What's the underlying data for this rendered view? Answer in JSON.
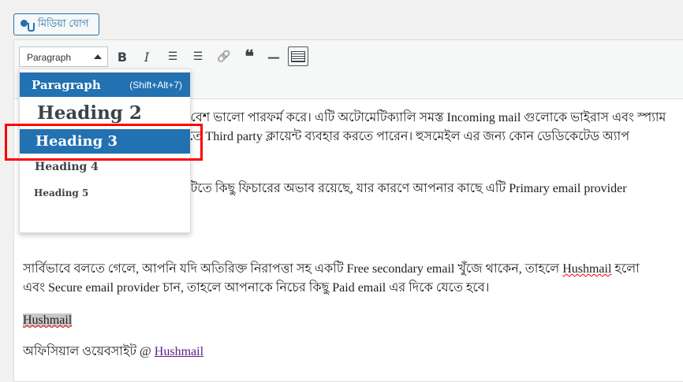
{
  "media_button": {
    "label": "মিডিয়া যোগ",
    "icon": "add-media-icon"
  },
  "toolbar": {
    "format_select": {
      "value": "Paragraph"
    },
    "buttons": [
      {
        "name": "bold",
        "glyph": "B"
      },
      {
        "name": "italic",
        "glyph": "I"
      },
      {
        "name": "bulleted-list",
        "glyph": "☰"
      },
      {
        "name": "numbered-list",
        "glyph": "☰"
      },
      {
        "name": "link",
        "glyph": "🔗"
      },
      {
        "name": "blockquote",
        "glyph": "❝"
      },
      {
        "name": "horizontal-line",
        "glyph": "—"
      },
      {
        "name": "toolbar-toggle",
        "glyph": ""
      }
    ]
  },
  "format_dropdown": {
    "items": [
      {
        "label": "Paragraph",
        "shortcut": "(Shift+Alt+7)"
      },
      {
        "label": "Heading 2"
      },
      {
        "label": "Heading 3"
      },
      {
        "label": "Heading 4"
      },
      {
        "label": "Heading 5"
      }
    ],
    "highlighted": "Heading 3",
    "accent": "#2271b1"
  },
  "content": {
    "lines": [
      "খুব বেশ ভালো পারফর্ম করে। এটি অটোমেটিক্যালি সমস্ত Incoming mail গুলোকে ভাইরাস এবং স্প্যাম",
      "করতে Third party ক্লায়েন্ট ব্যবহার করতে পারেন। হুসমেইল এর জন্য কোন ডেডিকেটেড অ্যাপ",
      "শনটিতে কিছু ফিচারের অভাব রয়েছে, যার কারণে আপনার কাছে এটি Primary email provider"
    ],
    "para2_a": "সার্বিভাবে বলতে গেলে, আপনি যদি অতিরিক্ত নিরাপত্তা সহ একটি Free secondary email খুঁজে থাকেন, তাহলে ",
    "para2_a_link": "Hushmail",
    "para2_a_end": " হলো",
    "para2_b": "এবং Secure email provider চান, তাহলে আপনাকে নিচের কিছু Paid email এর দিকে যেতে হবে।",
    "heading": "Hushmail",
    "official_prefix": "অফিসিয়াল ওয়েবসাইট @ ",
    "official_link": "Hushmail"
  }
}
